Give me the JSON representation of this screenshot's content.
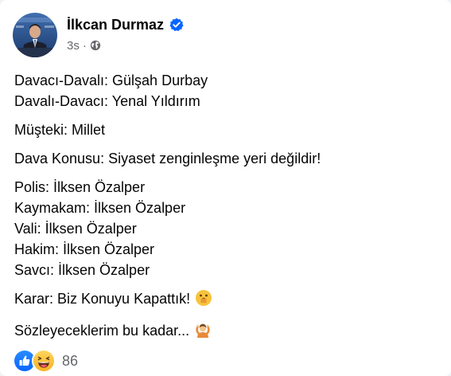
{
  "post": {
    "author": "İlkcan Durmaz",
    "verified": true,
    "timestamp": "3s",
    "separator": "·",
    "audience_icon": "globe-icon",
    "body": {
      "p1": {
        "line1": "Davacı-Davalı: Gülşah Durbay",
        "line2": "Davalı-Davacı: Yenal Yıldırım"
      },
      "p2": "Müşteki: Millet",
      "p3": "Dava Konusu: Siyaset zenginleşme yeri değildir!",
      "p4": {
        "line1": "Polis: İlksen Özalper",
        "line2": "Kaymakam: İlksen Özalper",
        "line3": "Vali: İlksen Özalper",
        "line4": "Hakim: İlksen Özalper",
        "line5": "Savcı: İlksen Özalper"
      },
      "p5": "Karar: Biz Konuyu Kapattık!",
      "p5_emoji": "face-with-open-mouth-hand-over-mouth",
      "p6": "Sözleyeceklerim bu kadar...",
      "p6_emoji": "person-gesturing-ok"
    },
    "reactions": {
      "icons": [
        "like-icon",
        "haha-icon"
      ],
      "count": "86"
    },
    "colors": {
      "verified_blue": "#0866ff",
      "like_blue": "#1877f2",
      "haha_yellow": "#f7b125",
      "secondary_text": "#65676b"
    }
  }
}
